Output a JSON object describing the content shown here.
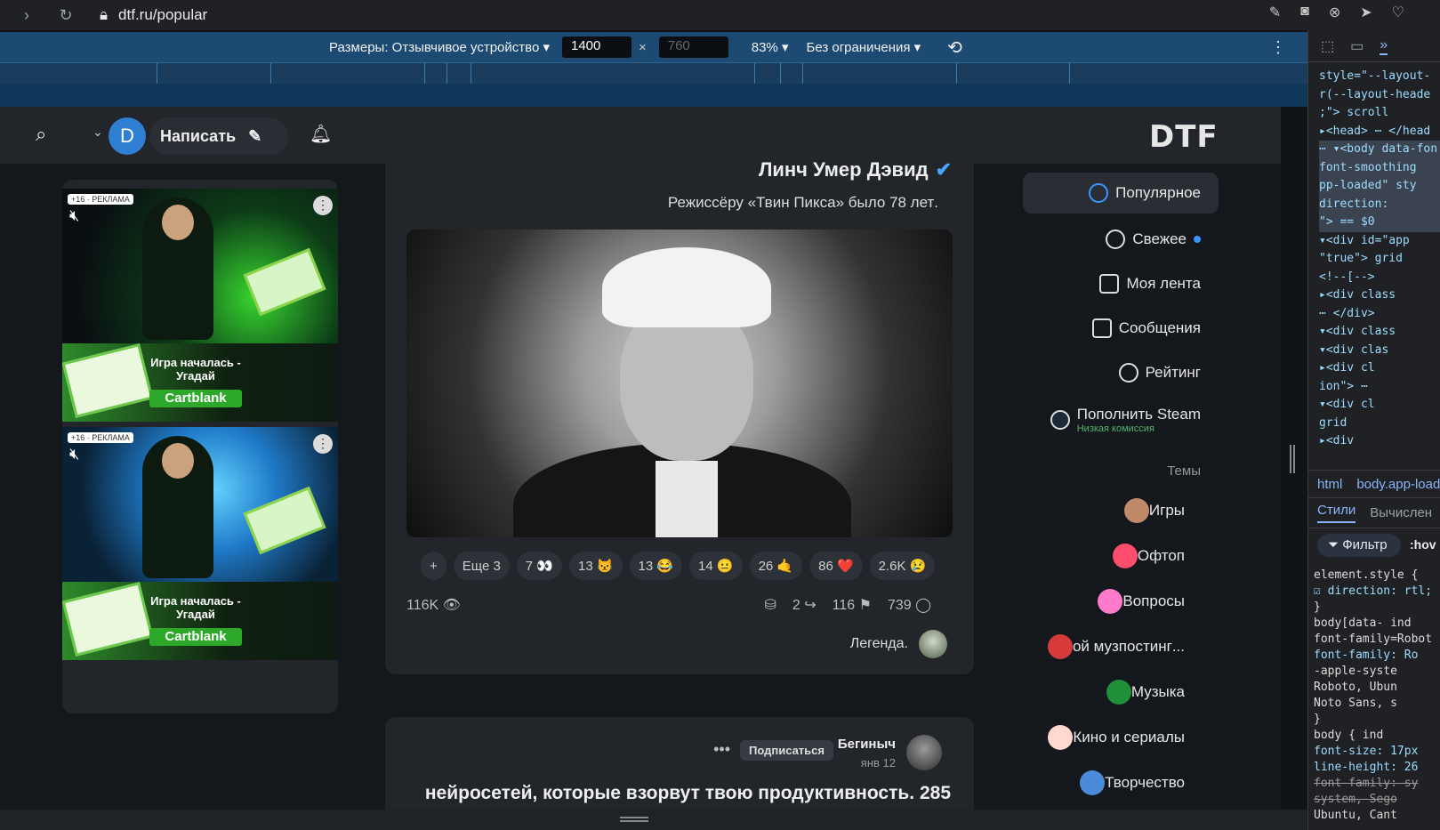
{
  "browser": {
    "url": "dtf.ru/popular"
  },
  "devbar": {
    "dimensions_label": "Размеры: Отзывчивое устройство ▾",
    "width": "1400",
    "height": "760",
    "times": "×",
    "zoom": "83% ▾",
    "limit": "Без ограничения ▾"
  },
  "header": {
    "avatar_letter": "D",
    "write_label": "Написать",
    "logo": "DTF"
  },
  "ads": [
    {
      "badge": "+16 · РЕКЛАМА",
      "line1": "Игра началась -",
      "line2": "Угадай",
      "brand": "Cartblank"
    },
    {
      "badge": "+16 · РЕКЛАМА",
      "line1": "Игра началась -",
      "line2": "Угадай",
      "brand": "Cartblank"
    }
  ],
  "post": {
    "title": "Линч Умер Дэвид",
    "subtitle": ".Режиссёру «Твин Пикса» было 78 лет",
    "reactions": [
      {
        "label": "+"
      },
      {
        "label": "Еще 3"
      },
      {
        "label": "7 👀"
      },
      {
        "label": "13 😾"
      },
      {
        "label": "13 😂"
      },
      {
        "label": "14 😐"
      },
      {
        "label": "26 🤙"
      },
      {
        "label": "86 ❤️"
      },
      {
        "label": "2.6K 😢"
      }
    ],
    "views": "116K",
    "reposts": "2",
    "bookmarks": "116",
    "comments": "739",
    "author": ".Легенда"
  },
  "post2": {
    "author": "Бегиныч",
    "date": "янв 12",
    "subscribe": "Подписаться",
    "headline": "нейросетей, которые взорвут твою продуктивность. 285"
  },
  "sidebar": {
    "nav": [
      {
        "label": "Популярное"
      },
      {
        "label": "Свежее"
      },
      {
        "label": "Моя лента"
      },
      {
        "label": "Сообщения"
      },
      {
        "label": "Рейтинг"
      },
      {
        "label": "Пополнить Steam",
        "sub": "Низкая комиссия"
      }
    ],
    "themes_title": "Темы",
    "themes": [
      {
        "label": "Игры",
        "color": "#c08a6a"
      },
      {
        "label": "Офтоп",
        "color": "#ff4d6d"
      },
      {
        "label": "Вопросы",
        "color": "#ff7ac8"
      },
      {
        "label": "...ой музпостинг",
        "color": "#d63a3a"
      },
      {
        "label": "Музыка",
        "color": "#1f8f3a"
      },
      {
        "label": "Кино и сериалы",
        "color": "#ffd9cf"
      },
      {
        "label": "Творчество",
        "color": "#4b8cd8"
      }
    ]
  },
  "devtools": {
    "dom_lines": [
      "style=\"--layout-",
      "r(--layout-heade",
      ";\"> scroll",
      "▸<head> ⋯ </head",
      "⋯ ▾<body data-fon",
      "font-smoothing",
      "pp-loaded\" sty",
      "direction:",
      "\"> == $0",
      "▾<div id=\"app",
      "\"true\"> grid",
      "<!--[-->",
      "▸<div class",
      "⋯ </div>",
      "▾<div class",
      "▾<div clas",
      "▸<div cl",
      "ion\"> ⋯",
      "▾<div cl",
      "grid",
      "▸<div"
    ],
    "crumb_html": "html",
    "crumb_body": "body.app-load",
    "tab_styles": "Стили",
    "tab_computed": "Вычислен",
    "filter": "Фильтр",
    "hov": ":hov",
    "css_lines": [
      "element.style {",
      "☑ direction: rtl;",
      "}",
      "body[data-      ind",
      "font-family=Robot",
      "  font-family: Ro",
      "    -apple-syste",
      "    Roboto, Ubun",
      "    Noto Sans, s",
      "}",
      "body {          ind",
      "  font-size: 17px",
      "  line-height: 26",
      "  font-family: sy",
      "    system, Sego",
      "    Ubuntu, Cant"
    ]
  }
}
